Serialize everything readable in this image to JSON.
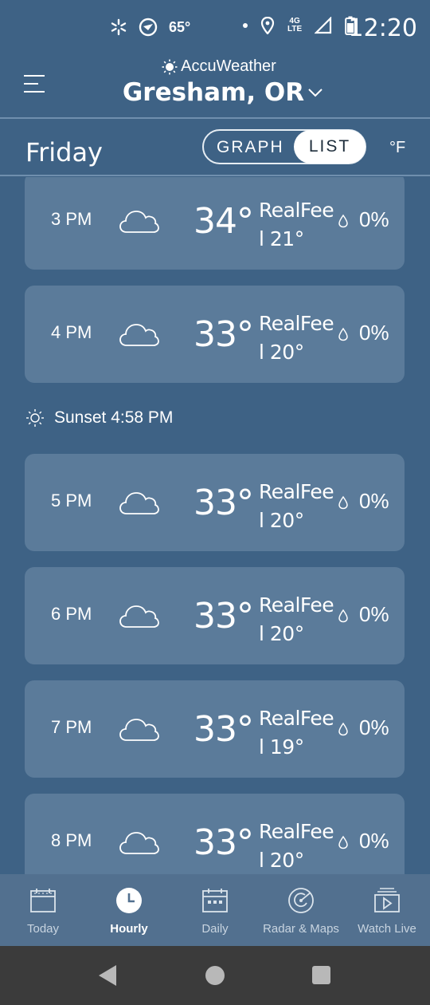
{
  "status_bar": {
    "temperature": "65°",
    "network": "4G LTE",
    "time": "12:20"
  },
  "header": {
    "brand": "AccuWeather",
    "location": "Gresham, OR"
  },
  "subheader": {
    "day": "Friday",
    "toggle": {
      "graph_label": "GRAPH",
      "list_label": "LIST",
      "selected": "LIST"
    },
    "unit": "°F"
  },
  "hourly": [
    {
      "hour": "3 PM",
      "temp": "34°",
      "realfeel": "RealFeel 21°",
      "precip": "0%"
    },
    {
      "hour": "4 PM",
      "temp": "33°",
      "realfeel": "RealFeel 20°",
      "precip": "0%"
    },
    {
      "hour": "5 PM",
      "temp": "33°",
      "realfeel": "RealFeel 20°",
      "precip": "0%"
    },
    {
      "hour": "6 PM",
      "temp": "33°",
      "realfeel": "RealFeel 20°",
      "precip": "0%"
    },
    {
      "hour": "7 PM",
      "temp": "33°",
      "realfeel": "RealFeel 19°",
      "precip": "0%"
    },
    {
      "hour": "8 PM",
      "temp": "33°",
      "realfeel": "RealFeel 20°",
      "precip": "0%"
    }
  ],
  "sunset": {
    "label": "Sunset 4:58 PM"
  },
  "bottom_nav": [
    {
      "label": "Today",
      "icon": "calendar-icon",
      "active": false
    },
    {
      "label": "Hourly",
      "icon": "clock-icon",
      "active": true
    },
    {
      "label": "Daily",
      "icon": "calendar-grid-icon",
      "active": false
    },
    {
      "label": "Radar & Maps",
      "icon": "radar-icon",
      "active": false
    },
    {
      "label": "Watch Live",
      "icon": "tv-play-icon",
      "active": false
    }
  ],
  "colors": {
    "background": "#3e6285",
    "card": "#5b7b9a",
    "nav": "#52708f",
    "system_nav": "#3b3b3b"
  }
}
